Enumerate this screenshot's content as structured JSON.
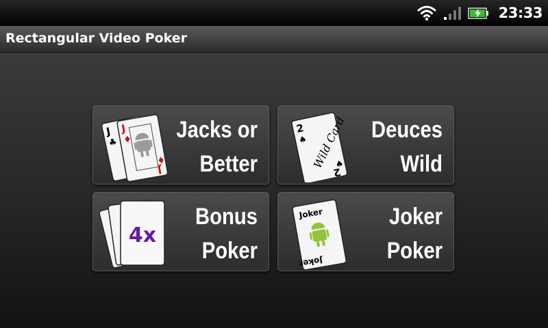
{
  "status_bar": {
    "time": "23:33",
    "icons": [
      "wifi-icon",
      "signal-icon",
      "battery-charging-icon"
    ]
  },
  "app": {
    "title": "Rectangular Video Poker"
  },
  "games": [
    {
      "line1": "Jacks or",
      "line2": "Better",
      "art": "jacks-cards-icon",
      "card_rank": "J"
    },
    {
      "line1": "Deuces",
      "line2": "Wild",
      "art": "wild-card-icon",
      "card_rank": "2",
      "card_text": "Wild Card"
    },
    {
      "line1": "Bonus",
      "line2": "Poker",
      "art": "bonus-cards-icon",
      "card_text": "4x"
    },
    {
      "line1": "Joker",
      "line2": "Poker",
      "art": "joker-card-icon",
      "card_text": "Joker"
    }
  ],
  "colors": {
    "card_red": "#d01010",
    "bonus_purple": "#6a1aa6",
    "android_green": "#8fc43c"
  }
}
